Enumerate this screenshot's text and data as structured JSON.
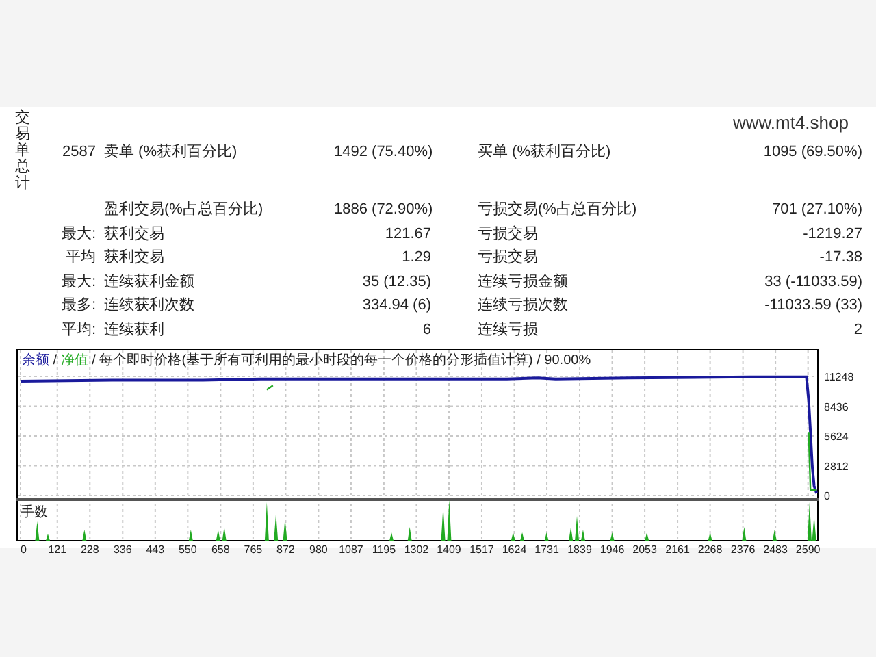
{
  "report": {
    "vertical_title": "交易单总计",
    "site": "www.mt4.shop",
    "rows": [
      {
        "prefix": "2587",
        "left_label": "卖单 (%获利百分比)",
        "left_value": "1492 (75.40%)",
        "right_label": "买单 (%获利百分比)",
        "right_value": "1095 (69.50%)"
      },
      {
        "left_label": "盈利交易(%占总百分比)",
        "left_value": "1886 (72.90%)",
        "right_label": "亏损交易(%占总百分比)",
        "right_value": "701 (27.10%)"
      },
      {
        "prefix": "最大:",
        "left_label": "获利交易",
        "left_value": "121.67",
        "right_label": "亏损交易",
        "right_value": "-1219.27"
      },
      {
        "prefix": "平均",
        "left_label": "获利交易",
        "left_value": "1.29",
        "right_label": "亏损交易",
        "right_value": "-17.38"
      },
      {
        "prefix": "最大:",
        "left_label": "连续获利金额",
        "left_value": "35 (12.35)",
        "right_label": "连续亏损金额",
        "right_value": "33 (-11033.59)"
      },
      {
        "prefix": "最多:",
        "left_label": "连续获利次数",
        "left_value": "334.94 (6)",
        "right_label": "连续亏损次数",
        "right_value": "-11033.59 (33)"
      },
      {
        "prefix": "平均:",
        "left_label": "连续获利",
        "left_value": "6",
        "right_label": "连续亏损",
        "right_value": "2"
      }
    ]
  },
  "chart": {
    "legend_separator": " / ",
    "volume_label": "手数",
    "chart_data": {
      "type": "line",
      "title": "每个即时价格(基于所有可利用的最小时段的每一个价格的分形插值计算) / 90.00%",
      "x": [
        0,
        300,
        600,
        790,
        810,
        830,
        850,
        1200,
        1600,
        1700,
        1760,
        2000,
        2400,
        2585,
        2592,
        2598,
        2604,
        2610,
        2618
      ],
      "series": [
        {
          "name": "余额",
          "color": "#1a1a9c",
          "values": [
            10800,
            10900,
            10900,
            11000,
            11000,
            11000,
            11000,
            11000,
            11000,
            11100,
            11000,
            11100,
            11200,
            11200,
            9000,
            6000,
            2800,
            900,
            200
          ]
        },
        {
          "name": "净值",
          "color": "#22aa22",
          "values": [
            null,
            null,
            null,
            null,
            10000,
            10400,
            null,
            null,
            null,
            null,
            null,
            null,
            null,
            null,
            6000,
            500,
            500,
            500,
            500
          ]
        }
      ],
      "xlim": [
        0,
        2620
      ],
      "grid": true,
      "xticks": [
        0,
        121,
        228,
        336,
        443,
        550,
        658,
        765,
        872,
        980,
        1087,
        1195,
        1302,
        1409,
        1517,
        1624,
        1731,
        1839,
        1946,
        2053,
        2161,
        2268,
        2376,
        2483,
        2590
      ],
      "yticks": [
        0,
        2812,
        5624,
        8436,
        11248
      ],
      "ylim": [
        0,
        11248
      ]
    }
  }
}
